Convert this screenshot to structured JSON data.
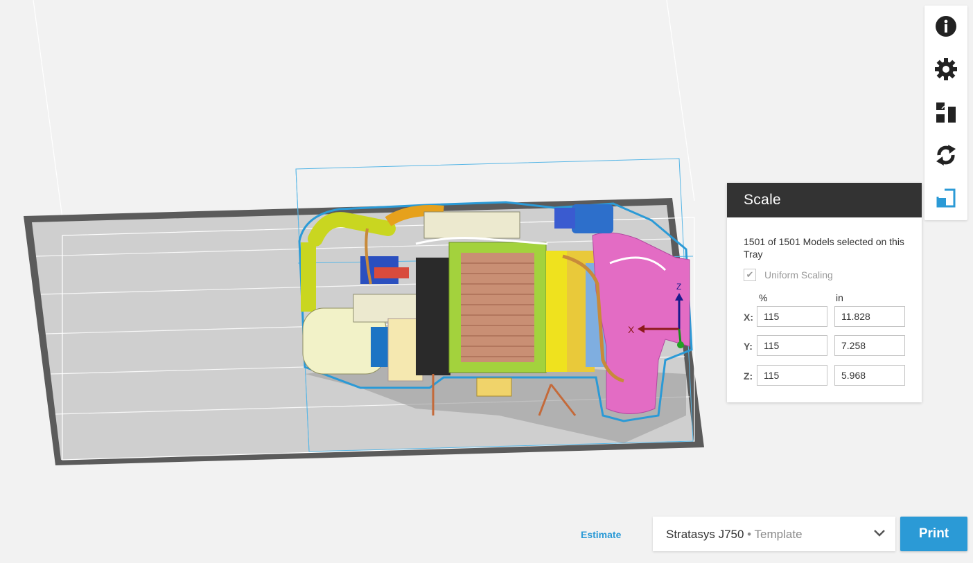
{
  "toolbar": {
    "icons": [
      "info-icon",
      "gear-icon",
      "arrange-icon",
      "rotate-icon",
      "scale-icon"
    ],
    "active_color": "#2b9ad6"
  },
  "scale_panel": {
    "title": "Scale",
    "selection_text": "1501 of 1501 Models selected on this Tray",
    "uniform_scaling_label": "Uniform Scaling",
    "uniform_scaling_checked": true,
    "percent_header": "%",
    "unit_header": "in",
    "rows": [
      {
        "axis": "X:",
        "percent": "115",
        "value": "11.828"
      },
      {
        "axis": "Y:",
        "percent": "115",
        "value": "7.258"
      },
      {
        "axis": "Z:",
        "percent": "115",
        "value": "5.968"
      }
    ]
  },
  "viewport": {
    "gizmo_x_label": "X",
    "gizmo_z_label": "Z"
  },
  "bottom_bar": {
    "estimate_label": "Estimate",
    "printer_name": "Stratasys J750",
    "printer_separator": " • ",
    "printer_mode": "Template",
    "print_label": "Print"
  },
  "colors": {
    "accent": "#2b9ad6",
    "panel_header": "#333333",
    "background": "#f2f2f2"
  }
}
